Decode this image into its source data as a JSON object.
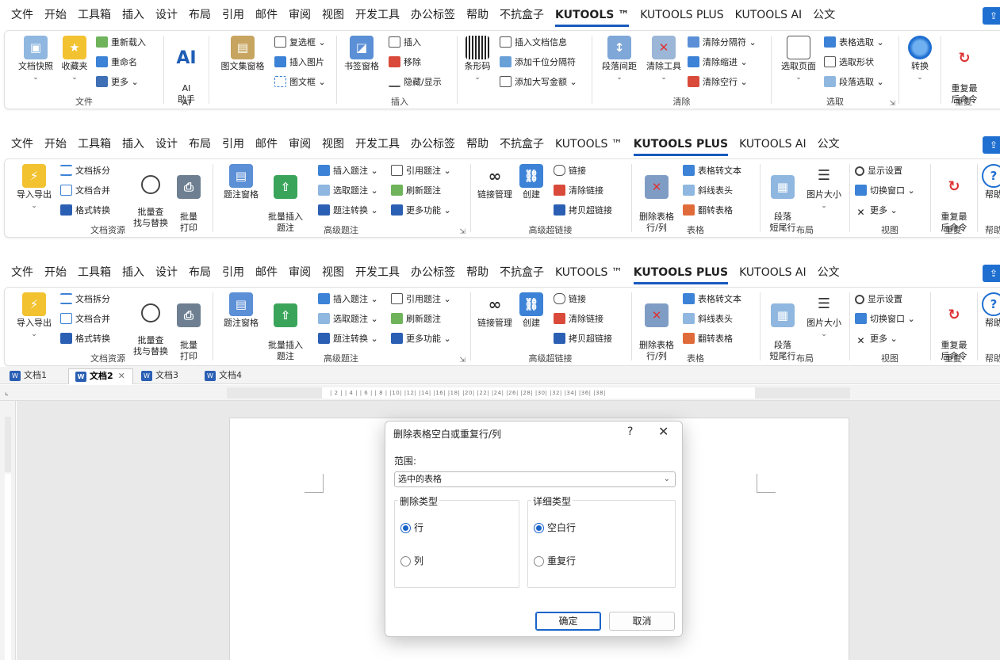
{
  "ribbon_tabs": [
    "文件",
    "开始",
    "工具箱",
    "插入",
    "设计",
    "布局",
    "引用",
    "邮件",
    "审阅",
    "视图",
    "开发工具",
    "办公标签",
    "帮助",
    "不抗盒子",
    "KUTOOLS ™",
    "KUTOOLS PLUS",
    "KUTOOLS AI",
    "公文"
  ],
  "kutools_ribbon": {
    "groups": {
      "file": "文件",
      "ai": "AI",
      "insert": "插入",
      "clear": "清除",
      "select": "选取",
      "repeat": "重复"
    },
    "buttons": {
      "doc_snapshot": "文档快照",
      "favorites": "收藏夹",
      "reload": "重新载入",
      "rename": "重命名",
      "more": "更多",
      "ai_assistant_icon": "AI",
      "ai_assistant": "AI\n助手",
      "gallery_pane": "图文集窗格",
      "checkbox": "复选框",
      "insert_image": "插入图片",
      "text_frame": "图文框",
      "bookmark_pane": "书签窗格",
      "insert": "插入",
      "remove": "移除",
      "hide_show": "隐藏/显示",
      "barcode": "条形码",
      "insert_doc_info": "插入文档信息",
      "add_thousands_sep": "添加千位分隔符",
      "add_uppercase_amount": "添加大写金额",
      "paragraph_spacing": "段落间距",
      "clear_tools": "清除工具",
      "clear_separator": "清除分隔符",
      "clear_indent": "清除缩进",
      "clear_blank_lines": "清除空行",
      "select_page": "选取页面",
      "select_table": "表格选取",
      "select_shape": "选取形状",
      "select_paragraph": "段落选取",
      "convert": "转换",
      "repeat_last": "重复最\n后命令"
    }
  },
  "plus_ribbon": {
    "groups": {
      "doc_resources": "文档资源",
      "advanced_captions": "高级题注",
      "advanced_hyperlinks": "高级超链接",
      "table": "表格",
      "layout": "布局",
      "view": "视图",
      "repeat": "重复",
      "help": "帮助"
    },
    "buttons": {
      "import_export": "导入导出",
      "split_doc": "文档拆分",
      "merge_doc": "文档合并",
      "format_convert": "格式转换",
      "batch_find_replace": "批量查\n找与替换",
      "batch_print": "批量\n打印",
      "caption_pane": "题注窗格",
      "batch_insert_caption": "批量插入\n题注",
      "insert_caption": "插入题注",
      "select_caption": "选取题注",
      "caption_convert": "题注转换",
      "cite_caption": "引用题注",
      "refresh_caption": "刷新题注",
      "more_functions": "更多功能",
      "link_manage": "链接管理",
      "create": "创建",
      "link": "链接",
      "clear_link": "清除链接",
      "copy_hyperlink": "拷贝超链接",
      "delete_table_rows_cols": "删除表格\n行/列",
      "table_to_text": "表格转文本",
      "diagonal_header": "斜线表头",
      "flip_table": "翻转表格",
      "paragraph_widow": "段落\n短尾行",
      "image_size": "图片大小",
      "display_settings": "显示设置",
      "switch_window": "切换窗口",
      "more": "更多",
      "repeat_last": "重复最\n后命令",
      "help": "帮助"
    }
  },
  "doc_tabs": [
    {
      "label": "文档1",
      "active": false
    },
    {
      "label": "文档2",
      "active": true
    },
    {
      "label": "文档3",
      "active": false
    },
    {
      "label": "文档4",
      "active": false
    }
  ],
  "ruler_text": "| 2 |  | 4 |  | 6 |  | 8 |  |10|  |12|  |14|  |16|  |18|  |20|  |22|  |24|  |26|  |28|  |30|  |32|  |34|  |36|  |38|",
  "dialog": {
    "title": "删除表格空白或重复行/列",
    "help": "?",
    "close": "✕",
    "scope_label": "范围:",
    "scope_value": "选中的表格",
    "delete_type": {
      "legend": "删除类型",
      "options": [
        "行",
        "列"
      ],
      "selected": "行"
    },
    "detail_type": {
      "legend": "详细类型",
      "options": [
        "空白行",
        "重复行"
      ],
      "selected": "空白行"
    },
    "ok": "确定",
    "cancel": "取消"
  },
  "colors": {
    "accent": "#1a64c8",
    "tab_underline": "#185abd"
  }
}
